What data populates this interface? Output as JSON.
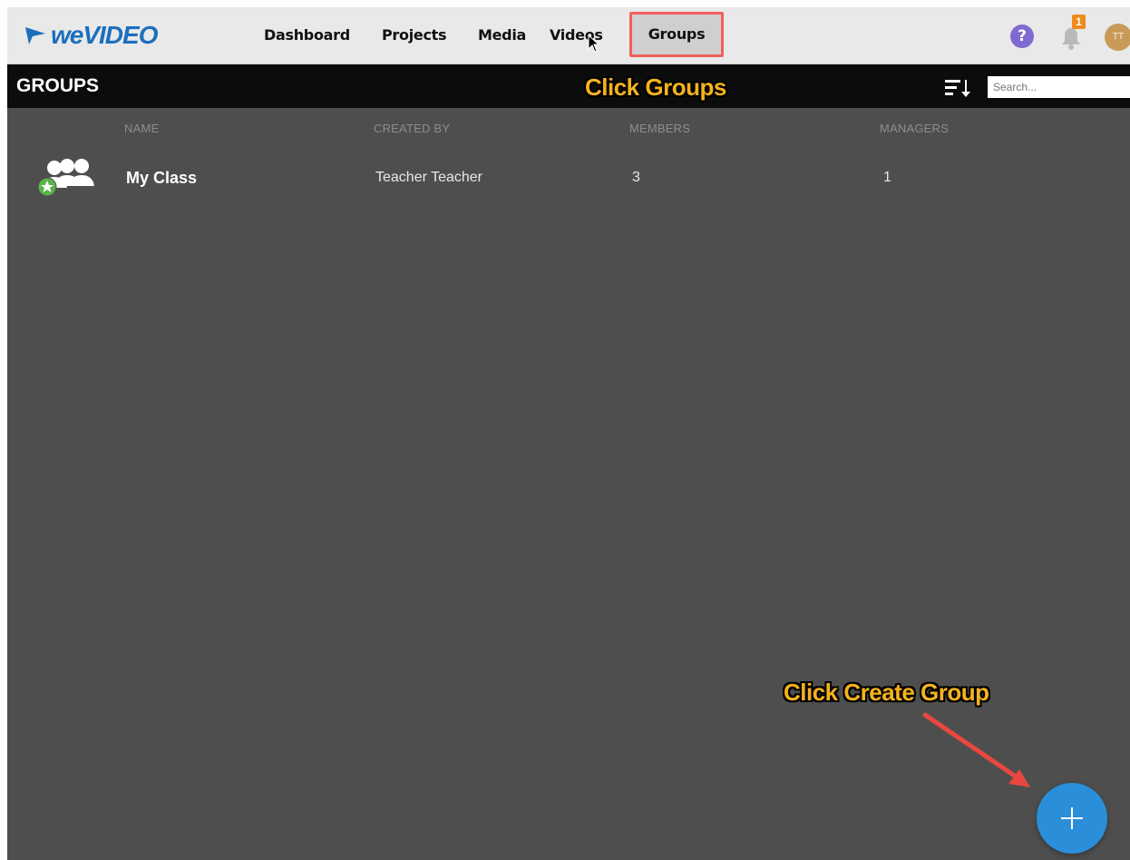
{
  "app": {
    "logo_text": "weVIDEO",
    "brand_color": "#1b6fbd"
  },
  "nav": {
    "items": [
      {
        "label": "Dashboard"
      },
      {
        "label": "Projects"
      },
      {
        "label": "Media"
      },
      {
        "label": "Videos"
      },
      {
        "label": "Groups",
        "active": true
      }
    ],
    "highlight_color": "#f0605a"
  },
  "header_icons": {
    "help": "?",
    "notification_count": "1",
    "avatar_initials": "TT"
  },
  "subheader": {
    "title": "GROUPS",
    "search_placeholder": "Search..."
  },
  "table": {
    "columns": [
      "NAME",
      "CREATED BY",
      "MEMBERS",
      "MANAGERS"
    ],
    "rows": [
      {
        "name": "My Class",
        "created_by": "Teacher Teacher",
        "members": "3",
        "managers": "1",
        "icon": "group-icon"
      }
    ]
  },
  "annotations": {
    "click_groups": "Click Groups",
    "click_create_group": "Click Create Group",
    "color": "#f6b21d"
  },
  "fab": {
    "icon": "plus-icon",
    "color": "#2a8ed8"
  }
}
